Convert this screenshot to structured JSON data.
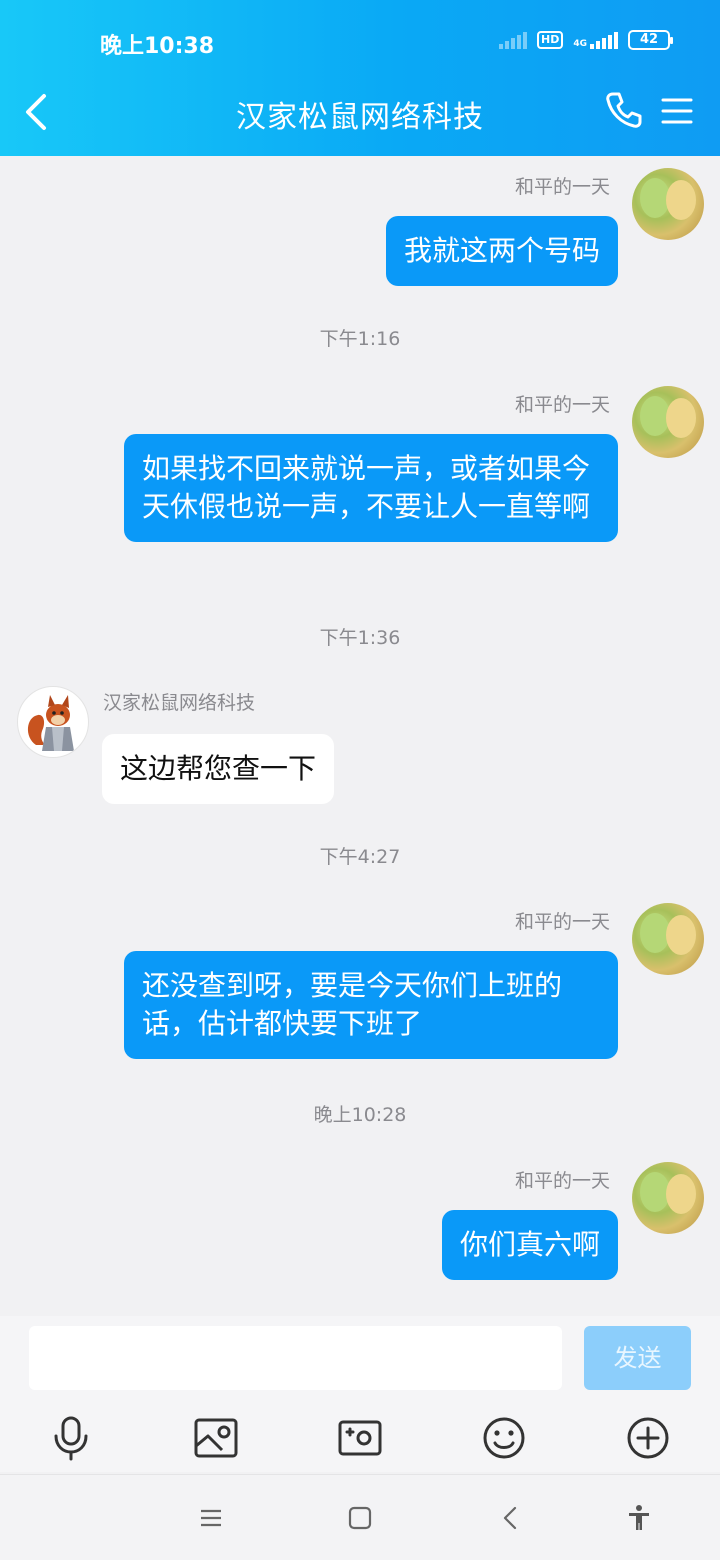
{
  "status_bar": {
    "time": "晚上10:38",
    "network_hd": "HD",
    "network_4g": "4G",
    "battery": "42"
  },
  "header": {
    "title": "汉家松鼠网络科技"
  },
  "messages": [
    {
      "side": "me",
      "sender": "和平的一天",
      "text": "我就这两个号码"
    },
    {
      "timestamp": "下午1:16"
    },
    {
      "side": "me",
      "sender": "和平的一天",
      "text": "如果找不回来就说一声，或者如果今天休假也说一声，不要让人一直等啊"
    },
    {
      "timestamp": "下午1:36"
    },
    {
      "side": "them",
      "sender": "汉家松鼠网络科技",
      "text": "这边帮您查一下"
    },
    {
      "timestamp": "下午4:27"
    },
    {
      "side": "me",
      "sender": "和平的一天",
      "text": "还没查到呀，要是今天你们上班的话，估计都快要下班了"
    },
    {
      "timestamp": "晚上10:28"
    },
    {
      "side": "me",
      "sender": "和平的一天",
      "text": "你们真六啊"
    }
  ],
  "input": {
    "value": "",
    "send_label": "发送"
  },
  "toolbar": [
    "microphone-icon",
    "image-icon",
    "camera-icon",
    "emoji-icon",
    "plus-icon"
  ],
  "colors": {
    "accent": "#0a99f8",
    "header_start": "#18c8f8",
    "header_end": "#0f9cf3",
    "send_disabled": "#8ccefb"
  }
}
